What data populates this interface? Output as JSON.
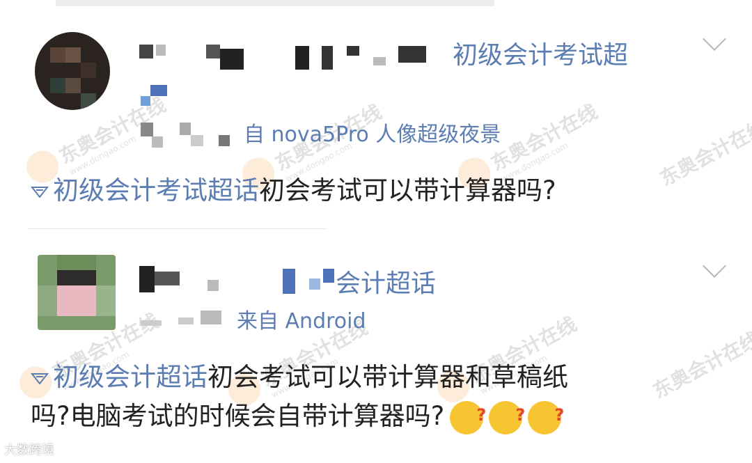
{
  "watermark": {
    "brand": "东奥会计在线",
    "url": "www.dongao.com"
  },
  "posts": [
    {
      "topic_fragment": "初级会计考试超",
      "meta_fragment": "自 nova5Pro 人像超级夜景",
      "topic_tag": "初级会计考试超话",
      "body": "初会考试可以带计算器吗?"
    },
    {
      "topic_fragment": "会计超话",
      "meta_fragment": "来自 Android",
      "topic_tag": "初级会计超话",
      "body_line1": "初会考试可以带计算器和草稿纸",
      "body_line2": "吗?电脑考试的时候会自带计算器吗?"
    }
  ],
  "footer": {
    "label": "大数跨境"
  },
  "colors": {
    "link": "#5b7db1",
    "text": "#222222",
    "emoji": "#f7c531"
  }
}
